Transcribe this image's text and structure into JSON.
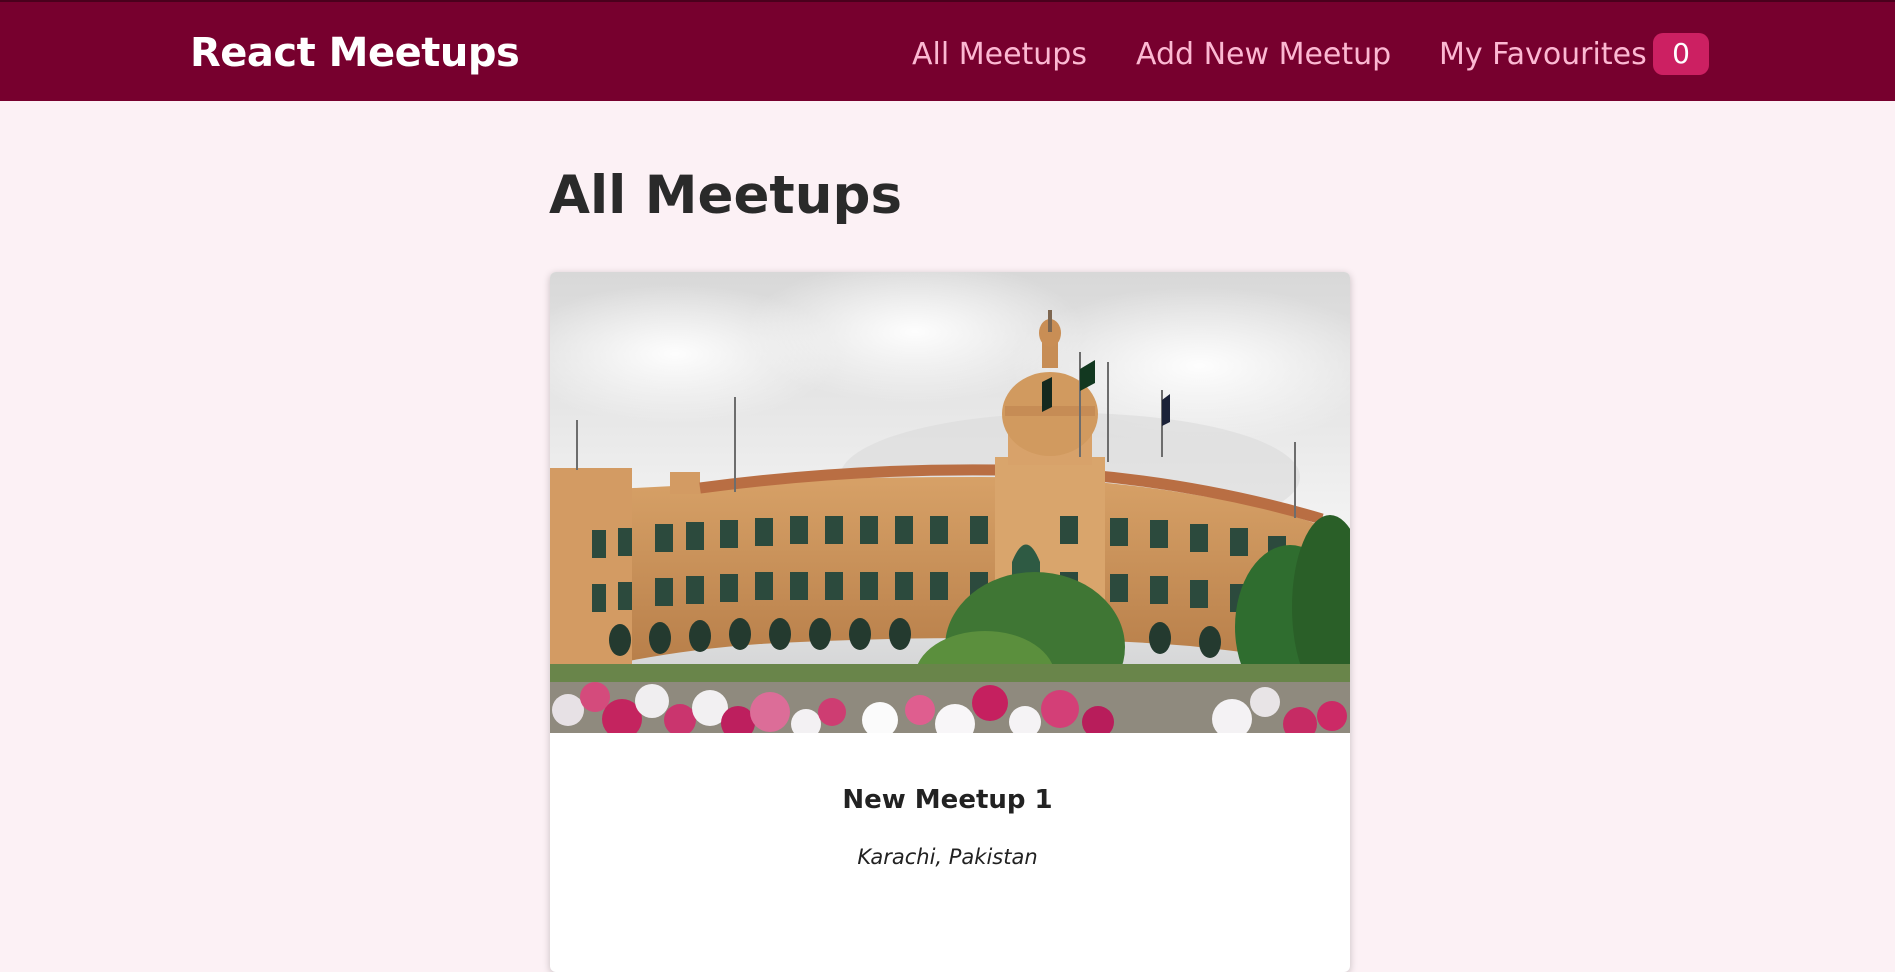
{
  "header": {
    "logo_text": "React Meetups",
    "nav": {
      "all_meetups": "All Meetups",
      "add_new_meetup": "Add New Meetup",
      "my_favourites": "My Favourites",
      "favourites_count": "0"
    }
  },
  "main": {
    "title": "All Meetups",
    "meetups": [
      {
        "image_alt": "New Meetup 1",
        "title": "New Meetup 1",
        "address": "Karachi, Pakistan"
      }
    ]
  },
  "colors": {
    "header_background": "#77002e",
    "nav_link": "#fcb8d2",
    "badge_background": "#cc2062",
    "page_background": "#fcf1f5"
  }
}
